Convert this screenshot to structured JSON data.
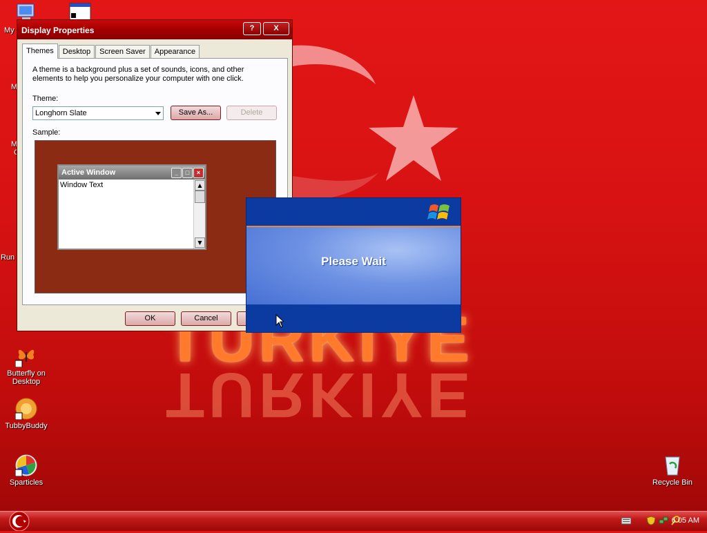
{
  "desktop": {
    "icons": [
      {
        "label": "Butterfly on Desktop"
      },
      {
        "label": "TubbyBuddy"
      },
      {
        "label": "Sparticles"
      },
      {
        "label": "Recycle Bin"
      }
    ],
    "partial_labels": {
      "my_computer": "My",
      "m1": "M",
      "m2": "M",
      "m2b": "C",
      "run": "Run"
    },
    "wallpaper_text": "TURKIYE",
    "colors": {
      "wallpaper": "#d71212",
      "moon": "#f08a8a"
    }
  },
  "display_properties": {
    "title": "Display Properties",
    "help_label": "?",
    "close_label": "X",
    "tabs": [
      {
        "label": "Themes",
        "active": true
      },
      {
        "label": "Desktop",
        "active": false
      },
      {
        "label": "Screen Saver",
        "active": false
      },
      {
        "label": "Appearance",
        "active": false
      }
    ],
    "description": "A theme is a background plus a set of sounds, icons, and other elements to help you personalize your computer with one click.",
    "theme_label": "Theme:",
    "theme_value": "Longhorn Slate",
    "save_as_label": "Save As...",
    "delete_label": "Delete",
    "sample_label": "Sample:",
    "sample_window": {
      "title": "Active Window",
      "text": "Window Text"
    },
    "ok_label": "OK",
    "cancel_label": "Cancel"
  },
  "please_wait": {
    "message": "Please Wait"
  },
  "taskbar": {
    "clock": "6:05 AM"
  }
}
